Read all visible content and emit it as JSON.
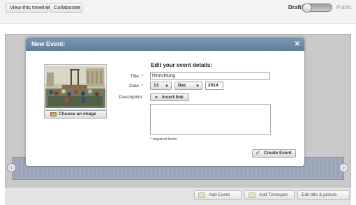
{
  "topbar": {
    "view_timeline": "View this timeline",
    "collaborate": "Collaborate",
    "draft": "Draft",
    "public": "Public",
    "toggle_state": "Draft"
  },
  "modal": {
    "title": "New Event:",
    "close": "✕",
    "choose_image": "Choose an image",
    "form_heading": "Edit your event details:",
    "title_label": "Title:",
    "title_value": "Hinrichtung",
    "date_label": "Date:",
    "day": "13",
    "month": "Dec",
    "year": "2014",
    "description_label": "Description:",
    "insert_link": "Insert link",
    "description_value": "",
    "required_note": "* required fields",
    "required_star": "*",
    "create_event": "Create Event"
  },
  "bottombar": {
    "add_event": "Add Event",
    "add_timespan": "Add Timespan",
    "edit_title": "Edit title & picture"
  },
  "nav": {
    "left": "‹",
    "right": "›"
  },
  "colors": {
    "header": "#6b88a6",
    "strip": "#9aa5b8",
    "required": "#cc0000"
  }
}
